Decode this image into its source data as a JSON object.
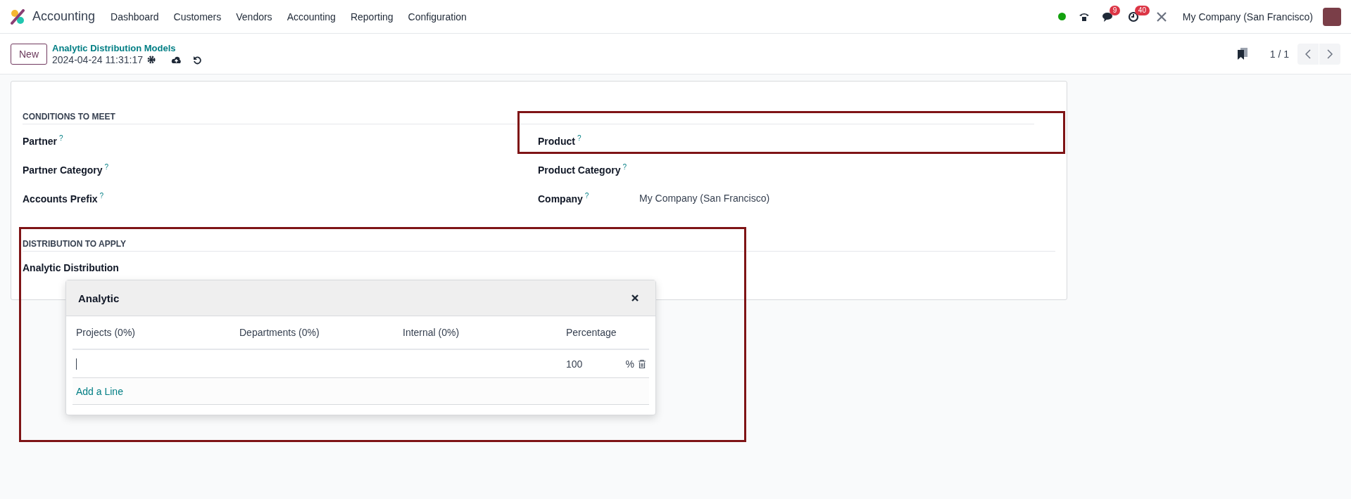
{
  "navbar": {
    "app_name": "Accounting",
    "menu": [
      "Dashboard",
      "Customers",
      "Vendors",
      "Accounting",
      "Reporting",
      "Configuration"
    ],
    "messages_count": "9",
    "activities_count": "40",
    "company": "My Company (San Francisco)"
  },
  "control_panel": {
    "new_button": "New",
    "breadcrumb": "Analytic Distribution Models",
    "record_name": "2024-04-24 11:31:17",
    "pager": "1 / 1"
  },
  "sections": [
    {
      "title": "CONDITIONS TO MEET",
      "left_fields": [
        {
          "label": "Partner",
          "help": "?"
        },
        {
          "label": "Partner Category",
          "help": "?"
        },
        {
          "label": "Accounts Prefix",
          "help": "?"
        }
      ],
      "right_fields": [
        {
          "label": "Product",
          "help": "?"
        },
        {
          "label": "Product Category",
          "help": "?"
        },
        {
          "label": "Company",
          "help": "?",
          "value": "My Company (San Francisco)"
        }
      ]
    },
    {
      "title": "DISTRIBUTION TO APPLY",
      "left_fields": [
        {
          "label": "Analytic Distribution"
        }
      ]
    }
  ],
  "popup": {
    "title": "Analytic",
    "columns": [
      "Projects (0%)",
      "Departments (0%)",
      "Internal (0%)",
      "Percentage"
    ],
    "lines": [
      {
        "percentage": "100",
        "unit": "%"
      }
    ],
    "add_line": "Add a Line"
  }
}
